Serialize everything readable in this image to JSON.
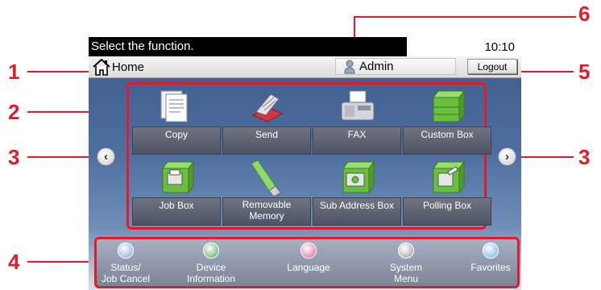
{
  "status_bar": {
    "message": "Select the function.",
    "time": "10:10"
  },
  "home_bar": {
    "home_label": "Home",
    "user_label": "Admin",
    "logout_label": "Logout"
  },
  "functions": [
    {
      "label": "Copy",
      "icon": "copy-icon"
    },
    {
      "label": "Send",
      "icon": "send-icon"
    },
    {
      "label": "FAX",
      "icon": "fax-icon"
    },
    {
      "label": "Custom Box",
      "icon": "custom-box-icon"
    },
    {
      "label": "Job Box",
      "icon": "job-box-icon"
    },
    {
      "label": "Removable\nMemory",
      "icon": "usb-memory-icon"
    },
    {
      "label": "Sub Address Box",
      "icon": "sub-address-box-icon"
    },
    {
      "label": "Polling Box",
      "icon": "polling-box-icon"
    }
  ],
  "dock": [
    {
      "label": "Status/\nJob Cancel",
      "icon": "status-icon",
      "color": "#7fa3dc"
    },
    {
      "label": "Device\nInformation",
      "icon": "device-info-icon",
      "color": "#4faa4f"
    },
    {
      "label": "Language",
      "icon": "language-icon",
      "color": "#e05a8a"
    },
    {
      "label": "System\nMenu",
      "icon": "system-menu-icon",
      "color": "#9a9a9a"
    },
    {
      "label": "Favorites",
      "icon": "favorites-icon",
      "color": "#6aaee0"
    }
  ],
  "callouts": [
    "1",
    "2",
    "3",
    "3",
    "4",
    "5",
    "6"
  ],
  "colors": {
    "callout": "#e21b2b",
    "tile": "#575d6b"
  }
}
